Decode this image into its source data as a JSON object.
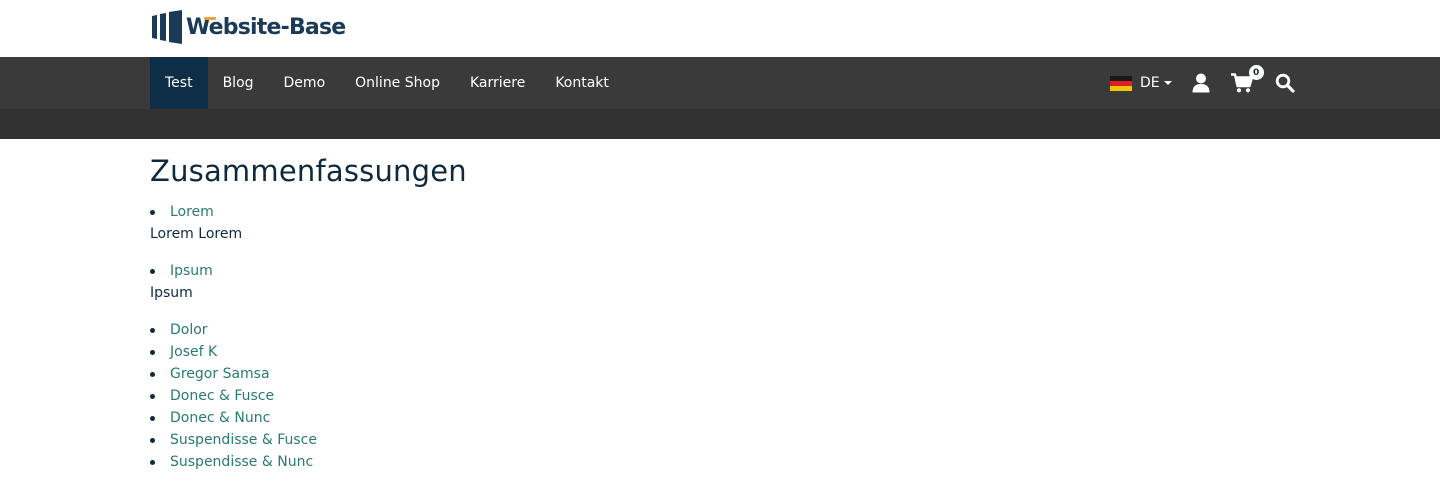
{
  "header": {
    "logo_text": "Website-Base",
    "brand_colors": {
      "primary": "#1a3a55",
      "accent": "#e8a33d"
    }
  },
  "nav": {
    "items": [
      {
        "label": "Test",
        "active": true
      },
      {
        "label": "Blog",
        "active": false
      },
      {
        "label": "Demo",
        "active": false
      },
      {
        "label": "Online Shop",
        "active": false
      },
      {
        "label": "Karriere",
        "active": false
      },
      {
        "label": "Kontakt",
        "active": false
      }
    ],
    "language": {
      "label": "DE",
      "icon": "germany-flag-icon"
    },
    "user_icon": "user-icon",
    "cart": {
      "icon": "shopping-cart-icon",
      "count": "0"
    },
    "search_icon": "search-icon",
    "colors": {
      "bar": "#3a3a3a",
      "active": "#0e2d46"
    }
  },
  "main": {
    "title": "Zusammenfassungen",
    "groups": [
      {
        "links": [
          "Lorem"
        ],
        "text": "Lorem Lorem"
      },
      {
        "links": [
          "Ipsum"
        ],
        "text": "Ipsum"
      },
      {
        "links": [
          "Dolor",
          "Josef K",
          "Gregor Samsa",
          "Donec & Fusce",
          "Donec & Nunc",
          "Suspendisse & Fusce",
          "Suspendisse & Nunc"
        ],
        "text": ""
      }
    ],
    "link_color": "#2a7a72"
  }
}
